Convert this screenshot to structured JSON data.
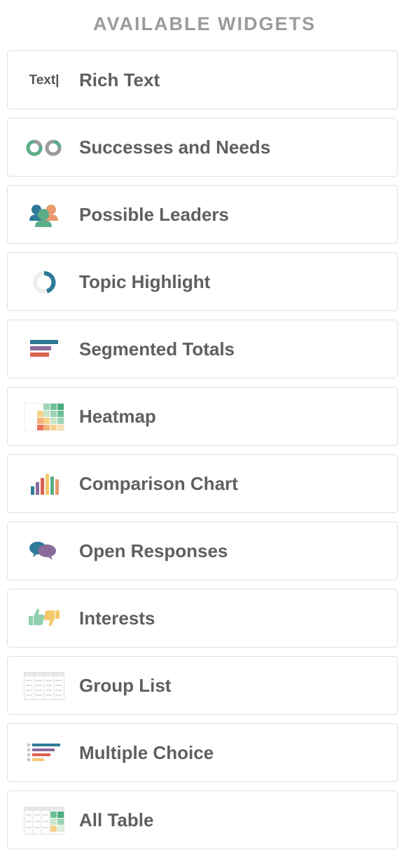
{
  "panel": {
    "title": "AVAILABLE WIDGETS"
  },
  "widgets": [
    {
      "label": "Rich Text",
      "icon": "rich-text-icon",
      "icon_text": "Text|"
    },
    {
      "label": "Successes and Needs",
      "icon": "successes-needs-icon"
    },
    {
      "label": "Possible Leaders",
      "icon": "possible-leaders-icon"
    },
    {
      "label": "Topic Highlight",
      "icon": "topic-highlight-icon"
    },
    {
      "label": "Segmented Totals",
      "icon": "segmented-totals-icon"
    },
    {
      "label": "Heatmap",
      "icon": "heatmap-icon"
    },
    {
      "label": "Comparison Chart",
      "icon": "comparison-chart-icon"
    },
    {
      "label": "Open Responses",
      "icon": "open-responses-icon"
    },
    {
      "label": "Interests",
      "icon": "interests-icon"
    },
    {
      "label": "Group List",
      "icon": "group-list-icon"
    },
    {
      "label": "Multiple Choice",
      "icon": "multiple-choice-icon"
    },
    {
      "label": "All Table",
      "icon": "all-table-icon"
    }
  ],
  "colors": {
    "teal": "#2e7a98",
    "green": "#5aad86",
    "orange": "#e89a6c",
    "purple": "#8a6a9a",
    "red": "#d9614f",
    "yellow": "#f3c96b",
    "gray": "#9b9b9b"
  }
}
